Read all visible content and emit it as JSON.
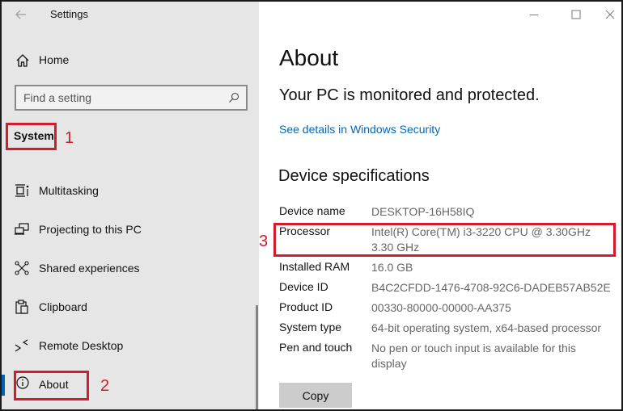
{
  "window": {
    "app_title": "Settings",
    "controls": {
      "minimize": "minimize-icon",
      "maximize": "maximize-icon",
      "close": "close-icon"
    }
  },
  "sidebar": {
    "back_icon": "back-arrow-icon",
    "home": {
      "label": "Home",
      "icon": "home-icon"
    },
    "search": {
      "placeholder": "Find a setting",
      "value": "",
      "icon": "search-icon"
    },
    "section_header": "System",
    "items": [
      {
        "label": "Multitasking",
        "icon": "multitasking-icon",
        "active": false
      },
      {
        "label": "Projecting to this PC",
        "icon": "projecting-icon",
        "active": false
      },
      {
        "label": "Shared experiences",
        "icon": "shared-experiences-icon",
        "active": false
      },
      {
        "label": "Clipboard",
        "icon": "clipboard-icon",
        "active": false
      },
      {
        "label": "Remote Desktop",
        "icon": "remote-desktop-icon",
        "active": false
      },
      {
        "label": "About",
        "icon": "info-icon",
        "active": true
      }
    ]
  },
  "content": {
    "title": "About",
    "protection_status": "Your PC is monitored and protected.",
    "security_link": "See details in Windows Security",
    "spec_heading": "Device specifications",
    "specs": [
      {
        "label": "Device name",
        "value": "DESKTOP-16H58IQ"
      },
      {
        "label": "Processor",
        "value": "Intel(R) Core(TM) i3-3220 CPU @ 3.30GHz   3.30 GHz"
      },
      {
        "label": "Installed RAM",
        "value": "16.0 GB"
      },
      {
        "label": "Device ID",
        "value": "B4C2CFDD-1476-4708-92C6-DADEB57AB52E"
      },
      {
        "label": "Product ID",
        "value": "00330-80000-00000-AA375"
      },
      {
        "label": "System type",
        "value": "64-bit operating system, x64-based processor"
      },
      {
        "label": "Pen and touch",
        "value": "No pen or touch input is available for this display"
      }
    ],
    "copy_button": "Copy"
  },
  "annotations": [
    {
      "number": "1",
      "target": "System"
    },
    {
      "number": "2",
      "target": "About"
    },
    {
      "number": "3",
      "target": "Processor"
    }
  ],
  "colors": {
    "accent": "#0063b1",
    "link": "#0067b8",
    "annotation": "#d11d2b",
    "sidebar_bg": "#e6e6e6"
  }
}
